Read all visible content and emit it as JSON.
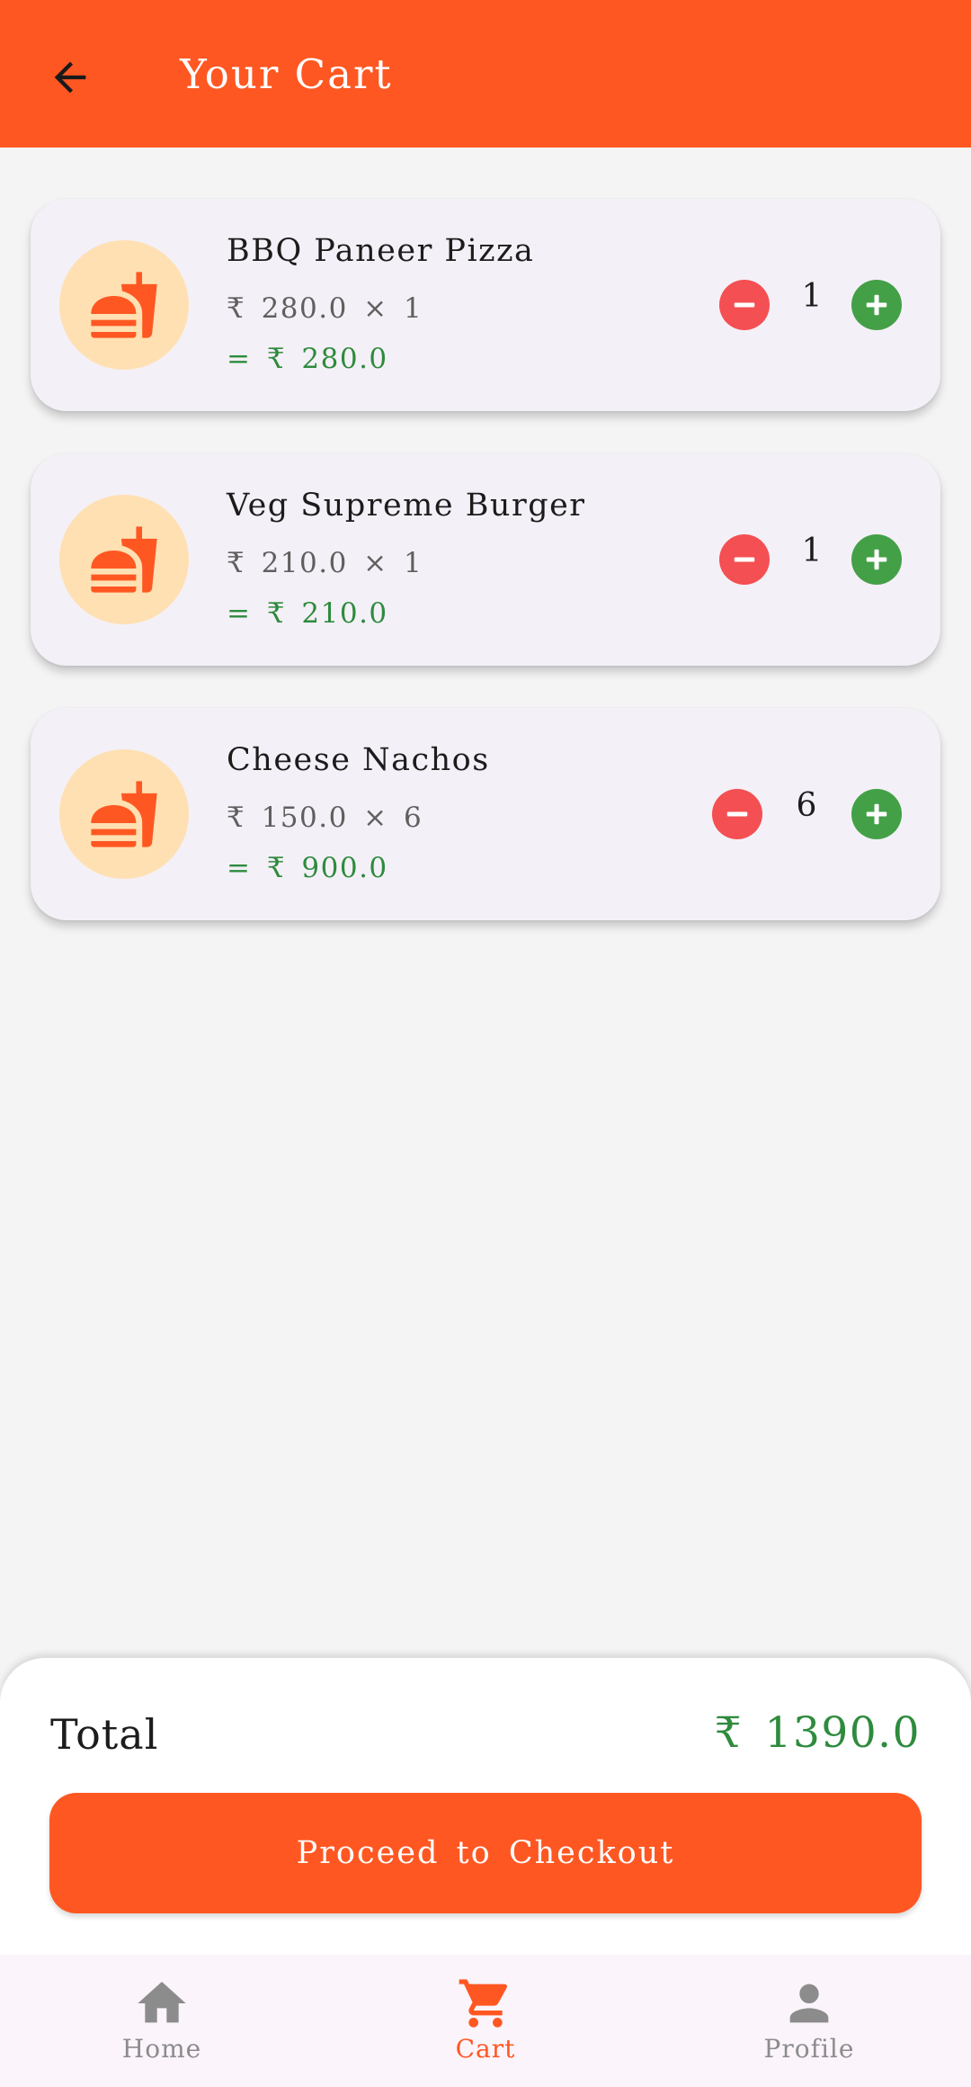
{
  "header": {
    "title": "Your Cart",
    "back_icon": "arrow-left-icon"
  },
  "cart": {
    "items": [
      {
        "name": "BBQ Paneer Pizza",
        "unit_line": "₹ 280.0 × 1",
        "subtotal_line": "= ₹ 280.0",
        "quantity": "1",
        "icon": "fastfood-icon"
      },
      {
        "name": "Veg Supreme Burger",
        "unit_line": "₹ 210.0 × 1",
        "subtotal_line": "= ₹ 210.0",
        "quantity": "1",
        "icon": "fastfood-icon"
      },
      {
        "name": "Cheese Nachos",
        "unit_line": "₹ 150.0 × 6",
        "subtotal_line": "= ₹ 900.0",
        "quantity": "6",
        "icon": "fastfood-icon"
      }
    ]
  },
  "summary": {
    "total_label": "Total",
    "total_value": "₹ 1390.0",
    "checkout_label": "Proceed to Checkout"
  },
  "nav": {
    "items": [
      {
        "label": "Home",
        "icon": "home-icon",
        "active": false
      },
      {
        "label": "Cart",
        "icon": "cart-icon",
        "active": true
      },
      {
        "label": "Profile",
        "icon": "person-icon",
        "active": false
      }
    ]
  },
  "colors": {
    "primary": "#ff5722",
    "price_green": "#2e8b3d",
    "minus_red": "#f44f52",
    "plus_green": "#43a047",
    "thumb_bg": "#ffe0b2",
    "card_bg": "#f4f0f7",
    "page_bg": "#f4f4f4",
    "nav_bg": "#fbf4fb",
    "inactive_gray": "#8c8c8c"
  }
}
